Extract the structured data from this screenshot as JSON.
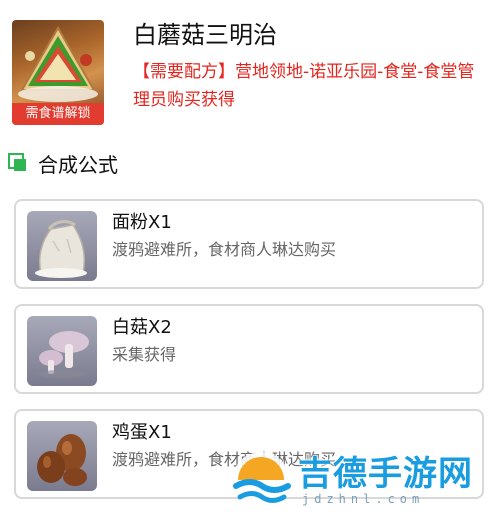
{
  "header": {
    "dish_name": "白蘑菇三明治",
    "unlock_badge": "需食谱解锁",
    "recipe_note": "【需要配方】营地领地-诺亚乐园-食堂-食堂管理员购买获得"
  },
  "section": {
    "title": "合成公式"
  },
  "ingredients": [
    {
      "name": "面粉X1",
      "source": "渡鸦避难所，食材商人琳达购买",
      "icon": "flour-sack-icon"
    },
    {
      "name": "白菇X2",
      "source": "采集获得",
      "icon": "white-mushroom-icon"
    },
    {
      "name": "鸡蛋X1",
      "source": "渡鸦避难所，食材商人琳达购买",
      "icon": "eggs-icon"
    }
  ],
  "watermark": {
    "brand": "吉德手游网",
    "url": "jdzhnl.com"
  },
  "colors": {
    "accent_red": "#e5251e",
    "section_icon_green": "#2fb552",
    "card_border": "#d8d8d8",
    "watermark_blue": "#1a9ce0"
  }
}
